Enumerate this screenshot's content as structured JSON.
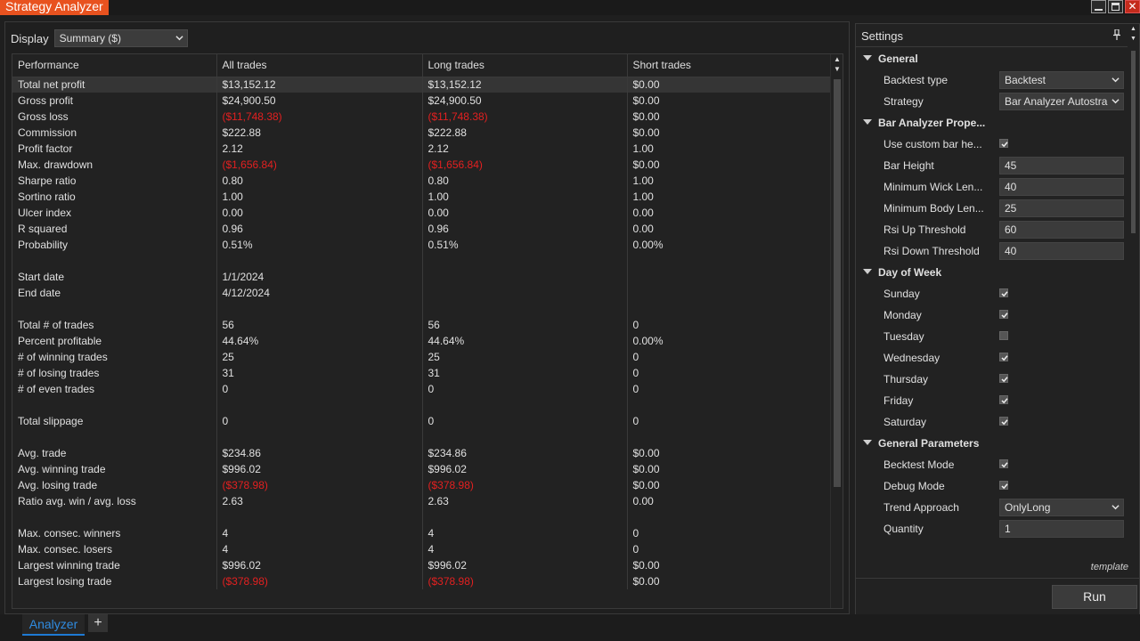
{
  "window": {
    "title": "Strategy Analyzer"
  },
  "display": {
    "label": "Display",
    "selected": "Summary ($)"
  },
  "table": {
    "headers": [
      "Performance",
      "All trades",
      "Long trades",
      "Short trades"
    ],
    "rows": [
      {
        "label": "Total net profit",
        "all": "$13,152.12",
        "long": "$13,152.12",
        "short": "$0.00"
      },
      {
        "label": "Gross profit",
        "all": "$24,900.50",
        "long": "$24,900.50",
        "short": "$0.00"
      },
      {
        "label": "Gross loss",
        "all": "($11,748.38)",
        "long": "($11,748.38)",
        "short": "$0.00"
      },
      {
        "label": "Commission",
        "all": "$222.88",
        "long": "$222.88",
        "short": "$0.00"
      },
      {
        "label": "Profit factor",
        "all": "2.12",
        "long": "2.12",
        "short": "1.00"
      },
      {
        "label": "Max. drawdown",
        "all": "($1,656.84)",
        "long": "($1,656.84)",
        "short": "$0.00"
      },
      {
        "label": "Sharpe ratio",
        "all": "0.80",
        "long": "0.80",
        "short": "1.00"
      },
      {
        "label": "Sortino ratio",
        "all": "1.00",
        "long": "1.00",
        "short": "1.00"
      },
      {
        "label": "Ulcer index",
        "all": "0.00",
        "long": "0.00",
        "short": "0.00"
      },
      {
        "label": "R squared",
        "all": "0.96",
        "long": "0.96",
        "short": "0.00"
      },
      {
        "label": "Probability",
        "all": "0.51%",
        "long": "0.51%",
        "short": "0.00%"
      },
      {
        "label": "",
        "all": "",
        "long": "",
        "short": ""
      },
      {
        "label": "Start date",
        "all": "1/1/2024",
        "long": "",
        "short": ""
      },
      {
        "label": "End date",
        "all": "4/12/2024",
        "long": "",
        "short": ""
      },
      {
        "label": "",
        "all": "",
        "long": "",
        "short": ""
      },
      {
        "label": "Total # of trades",
        "all": "56",
        "long": "56",
        "short": "0"
      },
      {
        "label": "Percent profitable",
        "all": "44.64%",
        "long": "44.64%",
        "short": "0.00%"
      },
      {
        "label": "# of winning trades",
        "all": "25",
        "long": "25",
        "short": "0"
      },
      {
        "label": "# of losing trades",
        "all": "31",
        "long": "31",
        "short": "0"
      },
      {
        "label": "# of even trades",
        "all": "0",
        "long": "0",
        "short": "0"
      },
      {
        "label": "",
        "all": "",
        "long": "",
        "short": ""
      },
      {
        "label": "Total slippage",
        "all": "0",
        "long": "0",
        "short": "0"
      },
      {
        "label": "",
        "all": "",
        "long": "",
        "short": ""
      },
      {
        "label": "Avg. trade",
        "all": "$234.86",
        "long": "$234.86",
        "short": "$0.00"
      },
      {
        "label": "Avg. winning trade",
        "all": "$996.02",
        "long": "$996.02",
        "short": "$0.00"
      },
      {
        "label": "Avg. losing trade",
        "all": "($378.98)",
        "long": "($378.98)",
        "short": "$0.00"
      },
      {
        "label": "Ratio avg. win / avg. loss",
        "all": "2.63",
        "long": "2.63",
        "short": "0.00"
      },
      {
        "label": "",
        "all": "",
        "long": "",
        "short": ""
      },
      {
        "label": "Max. consec. winners",
        "all": "4",
        "long": "4",
        "short": "0"
      },
      {
        "label": "Max. consec. losers",
        "all": "4",
        "long": "4",
        "short": "0"
      },
      {
        "label": "Largest winning trade",
        "all": "$996.02",
        "long": "$996.02",
        "short": "$0.00"
      },
      {
        "label": "Largest losing trade",
        "all": "($378.98)",
        "long": "($378.98)",
        "short": "$0.00"
      }
    ]
  },
  "settings": {
    "title": "Settings",
    "sections": [
      {
        "name": "General",
        "props": [
          {
            "name": "Backtest type",
            "type": "select",
            "value": "Backtest"
          },
          {
            "name": "Strategy",
            "type": "select",
            "value": "Bar Analyzer Autostra"
          }
        ]
      },
      {
        "name": "Bar Analyzer Prope...",
        "props": [
          {
            "name": "Use custom bar he...",
            "type": "checkbox",
            "checked": true
          },
          {
            "name": "Bar Height",
            "type": "input",
            "value": "45"
          },
          {
            "name": "Minimum Wick Len...",
            "type": "input",
            "value": "40"
          },
          {
            "name": "Minimum Body Len...",
            "type": "input",
            "value": "25"
          },
          {
            "name": "Rsi Up Threshold",
            "type": "input",
            "value": "60"
          },
          {
            "name": "Rsi Down Threshold",
            "type": "input",
            "value": "40"
          }
        ]
      },
      {
        "name": "Day of Week",
        "props": [
          {
            "name": "Sunday",
            "type": "checkbox",
            "checked": true
          },
          {
            "name": "Monday",
            "type": "checkbox",
            "checked": true
          },
          {
            "name": "Tuesday",
            "type": "checkbox",
            "checked": false
          },
          {
            "name": "Wednesday",
            "type": "checkbox",
            "checked": true
          },
          {
            "name": "Thursday",
            "type": "checkbox",
            "checked": true
          },
          {
            "name": "Friday",
            "type": "checkbox",
            "checked": true
          },
          {
            "name": "Saturday",
            "type": "checkbox",
            "checked": true
          }
        ]
      },
      {
        "name": "General Parameters",
        "props": [
          {
            "name": "Becktest Mode",
            "type": "checkbox",
            "checked": true
          },
          {
            "name": "Debug Mode",
            "type": "checkbox",
            "checked": true
          },
          {
            "name": "Trend Approach",
            "type": "select",
            "value": "OnlyLong"
          },
          {
            "name": "Quantity",
            "type": "input",
            "value": "1"
          }
        ]
      }
    ],
    "template_label": "template",
    "run_label": "Run"
  },
  "bottom_tabs": {
    "active": "Analyzer",
    "add": "+"
  },
  "colors": {
    "accent": "#e8521f",
    "negative": "#e32020",
    "tab_active": "#2f8be0"
  }
}
